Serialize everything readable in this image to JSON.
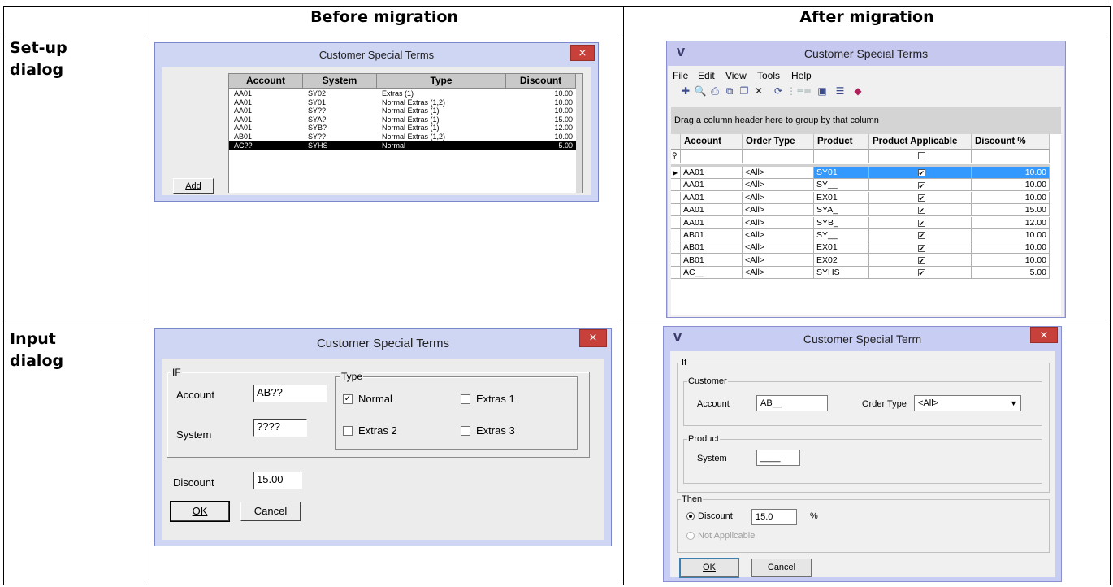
{
  "table": {
    "headers": {
      "before": "Before migration",
      "after": "After migration"
    },
    "rows": {
      "setup": "Set-up\ndialog",
      "input": "Input\ndialog"
    }
  },
  "old_setup": {
    "title": "Customer Special Terms",
    "close": "×",
    "columns": [
      "Account",
      "System",
      "Type",
      "Discount"
    ],
    "rows": [
      [
        "AA01",
        "SY02",
        "Extras (1)",
        "10.00"
      ],
      [
        "AA01",
        "SY01",
        "Normal Extras (1,2)",
        "10.00"
      ],
      [
        "AA01",
        "SY??",
        "Normal Extras (1)",
        "10.00"
      ],
      [
        "AA01",
        "SYA?",
        "Normal Extras (1)",
        "15.00"
      ],
      [
        "AA01",
        "SYB?",
        "Normal Extras (1)",
        "12.00"
      ],
      [
        "AB01",
        "SY??",
        "Normal Extras (1,2)",
        "10.00"
      ],
      [
        "AC??",
        "SYHS",
        "Normal",
        "5.00"
      ]
    ],
    "selected_row": 6,
    "add_button": "Add"
  },
  "new_setup": {
    "title": "Customer Special Terms",
    "menu": [
      "File",
      "Edit",
      "View",
      "Tools",
      "Help"
    ],
    "group_hint": "Drag a column header here to group by that column",
    "columns": [
      "Account",
      "Order Type",
      "Product",
      "Product Applicable",
      "Discount %"
    ],
    "rows": [
      [
        "AA01",
        "<All>",
        "SY01",
        "✔",
        "10.00"
      ],
      [
        "AA01",
        "<All>",
        "SY__",
        "✔",
        "10.00"
      ],
      [
        "AA01",
        "<All>",
        "EX01",
        "✔",
        "10.00"
      ],
      [
        "AA01",
        "<All>",
        "SYA_",
        "✔",
        "15.00"
      ],
      [
        "AA01",
        "<All>",
        "SYB_",
        "✔",
        "12.00"
      ],
      [
        "AB01",
        "<All>",
        "SY__",
        "✔",
        "10.00"
      ],
      [
        "AB01",
        "<All>",
        "EX01",
        "✔",
        "10.00"
      ],
      [
        "AB01",
        "<All>",
        "EX02",
        "✔",
        "10.00"
      ],
      [
        "AC__",
        "<All>",
        "SYHS",
        "✔",
        "5.00"
      ]
    ],
    "selected_row": 0
  },
  "old_input": {
    "title": "Customer Special Terms",
    "close": "×",
    "if_group": "IF",
    "account_label": "Account",
    "account_value": "AB??",
    "system_label": "System",
    "system_value": "????",
    "type_group": "Type",
    "types": [
      {
        "label": "Normal",
        "checked": true
      },
      {
        "label": "Extras 1",
        "checked": false
      },
      {
        "label": "Extras 2",
        "checked": false
      },
      {
        "label": "Extras 3",
        "checked": false
      }
    ],
    "discount_label": "Discount",
    "discount_value": "15.00",
    "ok": "OK",
    "cancel": "Cancel"
  },
  "new_input": {
    "title": "Customer Special Term",
    "close": "×",
    "if_group": "If",
    "customer_group": "Customer",
    "account_label": "Account",
    "account_value": "AB__",
    "order_type_label": "Order Type",
    "order_type_value": "<All>",
    "product_group": "Product",
    "system_label": "System",
    "system_value": "____",
    "then_group": "Then",
    "discount_label": "Discount",
    "discount_value": "15.0",
    "percent": "%",
    "not_applicable": "Not Applicable",
    "ok": "OK",
    "cancel": "Cancel"
  }
}
